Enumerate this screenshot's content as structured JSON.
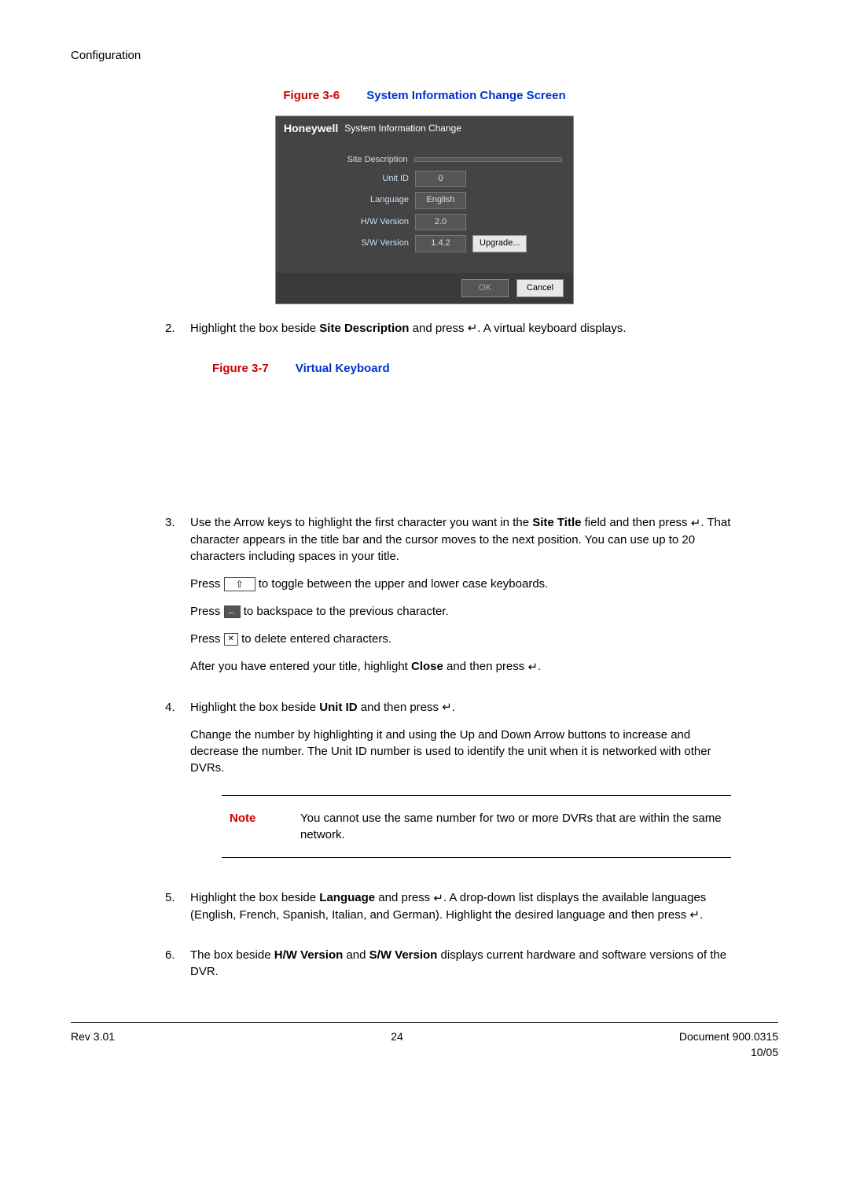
{
  "header": {
    "section": "Configuration"
  },
  "figure36": {
    "num": "Figure 3-6",
    "title": "System Information Change Screen"
  },
  "screenshot": {
    "brand": "Honeywell",
    "title": "System Information Change",
    "rows": {
      "siteDesc": {
        "label": "Site Description",
        "value": ""
      },
      "unitId": {
        "label": "Unit ID",
        "value": "0"
      },
      "language": {
        "label": "Language",
        "value": "English"
      },
      "hw": {
        "label": "H/W Version",
        "value": "2.0"
      },
      "sw": {
        "label": "S/W Version",
        "value": "1.4.2"
      }
    },
    "upgrade": "Upgrade...",
    "ok": "OK",
    "cancel": "Cancel"
  },
  "steps": {
    "s2": {
      "num": "2.",
      "a": "Highlight the box beside ",
      "b": "Site Description",
      "c": " and press ",
      "d": ". A virtual keyboard displays."
    },
    "fig37": {
      "num": "Figure 3-7",
      "title": "Virtual Keyboard"
    },
    "s3": {
      "num": "3.",
      "p1a": "Use the Arrow keys to highlight the first character you want in the ",
      "p1b": "Site Title",
      "p1c": " field and then press ",
      "p1d": ". That character appears in the title bar and the cursor moves to the next position. You can use up to 20 characters including spaces in your title.",
      "p2a": "Press ",
      "p2b": " to toggle between the upper and lower case keyboards.",
      "p3a": "Press ",
      "p3b": " to backspace to the previous character.",
      "p4a": "Press ",
      "p4b": " to delete entered characters.",
      "p5a": "After you have entered your title, highlight ",
      "p5b": "Close",
      "p5c": " and then press ",
      "p5d": "."
    },
    "s4": {
      "num": "4.",
      "p1a": "Highlight the box beside ",
      "p1b": "Unit ID",
      "p1c": " and then press ",
      "p1d": ".",
      "p2": "Change the number by highlighting it and using the Up and Down Arrow buttons to increase and decrease the number. The Unit ID number is used to identify the unit when it is networked with other DVRs."
    },
    "note": {
      "label": "Note",
      "text": "You cannot use the same number for two or more DVRs that are within the same network."
    },
    "s5": {
      "num": "5.",
      "a": "Highlight the box beside ",
      "b": "Language",
      "c": " and press ",
      "d": ". A drop-down list displays the available languages (English, French, Spanish, Italian, and German). Highlight the desired language and then press ",
      "e": "."
    },
    "s6": {
      "num": "6.",
      "a": "The box beside ",
      "b": "H/W Version",
      "c": " and ",
      "d": "S/W Version",
      "e": " displays current hardware and software versions of the DVR."
    }
  },
  "footer": {
    "rev": "Rev 3.01",
    "page": "24",
    "doc": "Document 900.0315",
    "date": "10/05"
  }
}
